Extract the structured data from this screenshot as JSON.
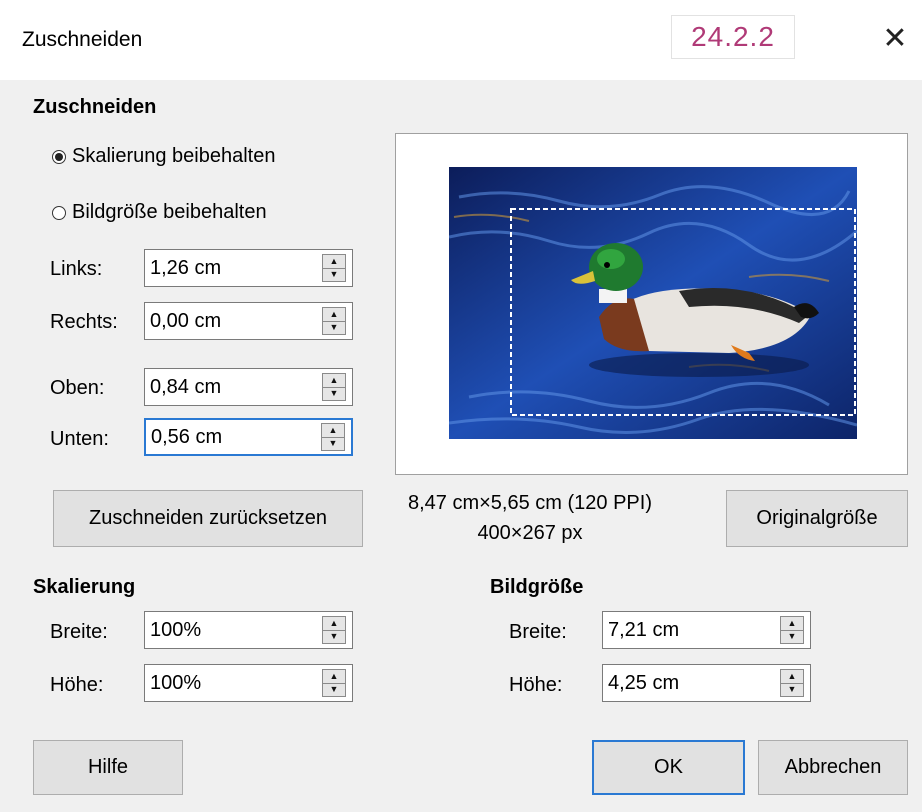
{
  "window": {
    "title": "Zuschneiden",
    "version_badge": "24.2.2"
  },
  "crop": {
    "heading": "Zuschneiden",
    "options": [
      {
        "label": "Skalierung beibehalten",
        "checked": true
      },
      {
        "label": "Bildgröße beibehalten",
        "checked": false
      }
    ],
    "left": {
      "label": "Links:",
      "value": "1,26 cm"
    },
    "right": {
      "label": "Rechts:",
      "value": "0,00 cm"
    },
    "top": {
      "label": "Oben:",
      "value": "0,84 cm"
    },
    "bottom": {
      "label": "Unten:",
      "value": "0,56 cm"
    },
    "reset_button": "Zuschneiden zurücksetzen"
  },
  "preview": {
    "dimensions": "8,47 cm×5,65 cm (120 PPI)",
    "pixels": "400×267 px",
    "original_size_button": "Originalgröße"
  },
  "scale": {
    "heading": "Skalierung",
    "width": {
      "label": "Breite:",
      "value": "100%"
    },
    "height": {
      "label": "Höhe:",
      "value": "100%"
    }
  },
  "image_size": {
    "heading": "Bildgröße",
    "width": {
      "label": "Breite:",
      "value": "7,21 cm"
    },
    "height": {
      "label": "Höhe:",
      "value": "4,25 cm"
    }
  },
  "buttons": {
    "help": "Hilfe",
    "ok": "OK",
    "cancel": "Abbrechen"
  },
  "colors": {
    "accent": "#2a79d3",
    "badge_text": "#b03a77",
    "background": "#f0f0f0"
  }
}
